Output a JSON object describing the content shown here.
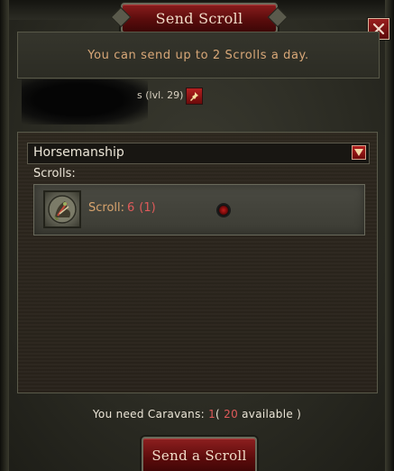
{
  "window": {
    "title": "Send Scroll",
    "close_label": "✕"
  },
  "info": {
    "message": "You can send up to 2 Scrolls a day."
  },
  "recipient": {
    "level": "s (lvl. 29)"
  },
  "scroll_type": {
    "selected": "Horsemanship"
  },
  "scrolls": {
    "label": "Scrolls:",
    "items": [
      {
        "label": "Scroll:",
        "count": "6",
        "paren": "(1)"
      }
    ]
  },
  "caravans": {
    "prefix": "You need Caravans:",
    "needed": "1",
    "open_paren": "(",
    "available": "20",
    "suffix": "available )"
  },
  "actions": {
    "send_label": "Send a Scroll"
  },
  "colors": {
    "accent_red": "#8e1f1f",
    "text_orange": "#d9a878",
    "highlight_red": "#e05a5a"
  },
  "icons": [
    "close-icon",
    "pin-icon",
    "dropdown-arrow-icon",
    "scroll-item-icon",
    "radio-icon"
  ]
}
